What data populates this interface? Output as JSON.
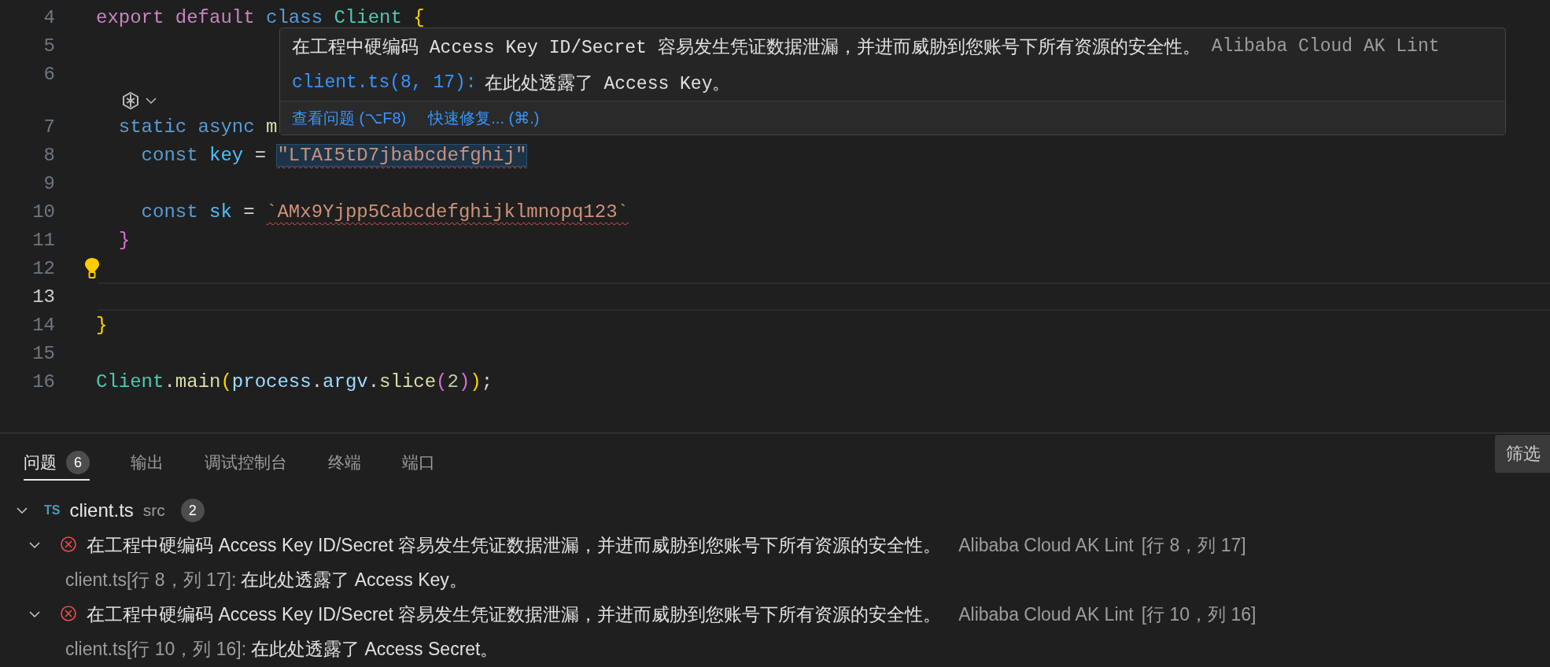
{
  "editor": {
    "lines": [
      {
        "kind": "code",
        "number": "4",
        "current": false,
        "tokens": [
          {
            "text": "export default ",
            "kind": "keyword"
          },
          {
            "text": "class ",
            "kind": "storage"
          },
          {
            "text": "Client ",
            "kind": "class"
          },
          {
            "text": "{",
            "kind": "bracket1"
          }
        ]
      },
      {
        "kind": "code",
        "number": "5",
        "current": false
      },
      {
        "kind": "code",
        "number": "6",
        "current": false
      },
      {
        "kind": "codelens"
      },
      {
        "kind": "code",
        "number": "7",
        "current": false,
        "tokens": [
          {
            "text": "  static async ",
            "kind": "storage"
          },
          {
            "text": "m",
            "kind": "function"
          }
        ]
      },
      {
        "kind": "code",
        "number": "8",
        "current": false,
        "tokens": [
          {
            "text": "    const ",
            "kind": "storage"
          },
          {
            "text": "key",
            "kind": "variable"
          },
          {
            "text": " = ",
            "kind": "punct"
          },
          {
            "text": "\"LTAI5tD7jbabcdefghij\"",
            "kind": "string",
            "error": true,
            "highlighted": true
          }
        ]
      },
      {
        "kind": "code",
        "number": "9",
        "current": false
      },
      {
        "kind": "code",
        "number": "10",
        "current": false,
        "tokens": [
          {
            "text": "    const ",
            "kind": "storage"
          },
          {
            "text": "sk",
            "kind": "variable"
          },
          {
            "text": " = ",
            "kind": "punct"
          },
          {
            "text": "`AMx9Yjpp5Cabcdefghijklmnopq123`",
            "kind": "string",
            "error": true,
            "highlighted": false
          }
        ]
      },
      {
        "kind": "code",
        "number": "11",
        "current": false,
        "tokens": [
          {
            "text": "  }",
            "kind": "bracket2"
          }
        ]
      },
      {
        "kind": "code",
        "number": "12",
        "current": false,
        "lightbulb": true
      },
      {
        "kind": "code",
        "number": "13",
        "current": true
      },
      {
        "kind": "code",
        "number": "14",
        "current": false,
        "tokens": [
          {
            "text": "}",
            "kind": "bracket1"
          }
        ]
      },
      {
        "kind": "code",
        "number": "15",
        "current": false
      },
      {
        "kind": "code",
        "number": "16",
        "current": false,
        "tokens": [
          {
            "text": "Client",
            "kind": "class"
          },
          {
            "text": ".",
            "kind": "punct"
          },
          {
            "text": "main",
            "kind": "function"
          },
          {
            "text": "(",
            "kind": "bracket1"
          },
          {
            "text": "process",
            "kind": "property"
          },
          {
            "text": ".",
            "kind": "punct"
          },
          {
            "text": "argv",
            "kind": "property"
          },
          {
            "text": ".",
            "kind": "punct"
          },
          {
            "text": "slice",
            "kind": "function"
          },
          {
            "text": "(",
            "kind": "bracket2"
          },
          {
            "text": "2",
            "kind": "number"
          },
          {
            "text": ")",
            "kind": "bracket2"
          },
          {
            "text": ")",
            "kind": "bracket1"
          },
          {
            "text": ";",
            "kind": "punct"
          }
        ]
      }
    ]
  },
  "hover": {
    "message": "在工程中硬编码 Access Key ID/Secret 容易发生凭证数据泄漏，并进而威胁到您账号下所有资源的安全性。",
    "source": "Alibaba Cloud AK Lint",
    "location": "client.ts(8, 17):",
    "detail": "在此处透露了 Access Key。",
    "actions": [
      "查看问题 (⌥F8)",
      "快速修复... (⌘.)"
    ]
  },
  "panel": {
    "tabs": [
      {
        "label": "问题",
        "badge": "6",
        "selected": true
      },
      {
        "label": "输出",
        "selected": false
      },
      {
        "label": "调试控制台",
        "selected": false
      },
      {
        "label": "终端",
        "selected": false
      },
      {
        "label": "端口",
        "selected": false
      }
    ],
    "filter_button": "筛选",
    "files": [
      {
        "icon_label": "TS",
        "name": "client.ts",
        "folder": "src",
        "count": "2",
        "expanded": true,
        "problems": [
          {
            "kind": "error",
            "expanded": true,
            "message": "在工程中硬编码 Access Key ID/Secret 容易发生凭证数据泄漏，并进而威胁到您账号下所有资源的安全性。",
            "source": "Alibaba Cloud AK Lint",
            "position": "[行 8，列 17]",
            "location": "client.ts[行 8，列 17]:",
            "detail": "在此处透露了 Access Key。"
          },
          {
            "kind": "error",
            "expanded": true,
            "message": "在工程中硬编码 Access Key ID/Secret 容易发生凭证数据泄漏，并进而威胁到您账号下所有资源的安全性。",
            "source": "Alibaba Cloud AK Lint",
            "position": "[行 10，列 16]",
            "location": "client.ts[行 10，列 16]:",
            "detail": "在此处透露了 Access Secret。"
          }
        ]
      }
    ]
  }
}
